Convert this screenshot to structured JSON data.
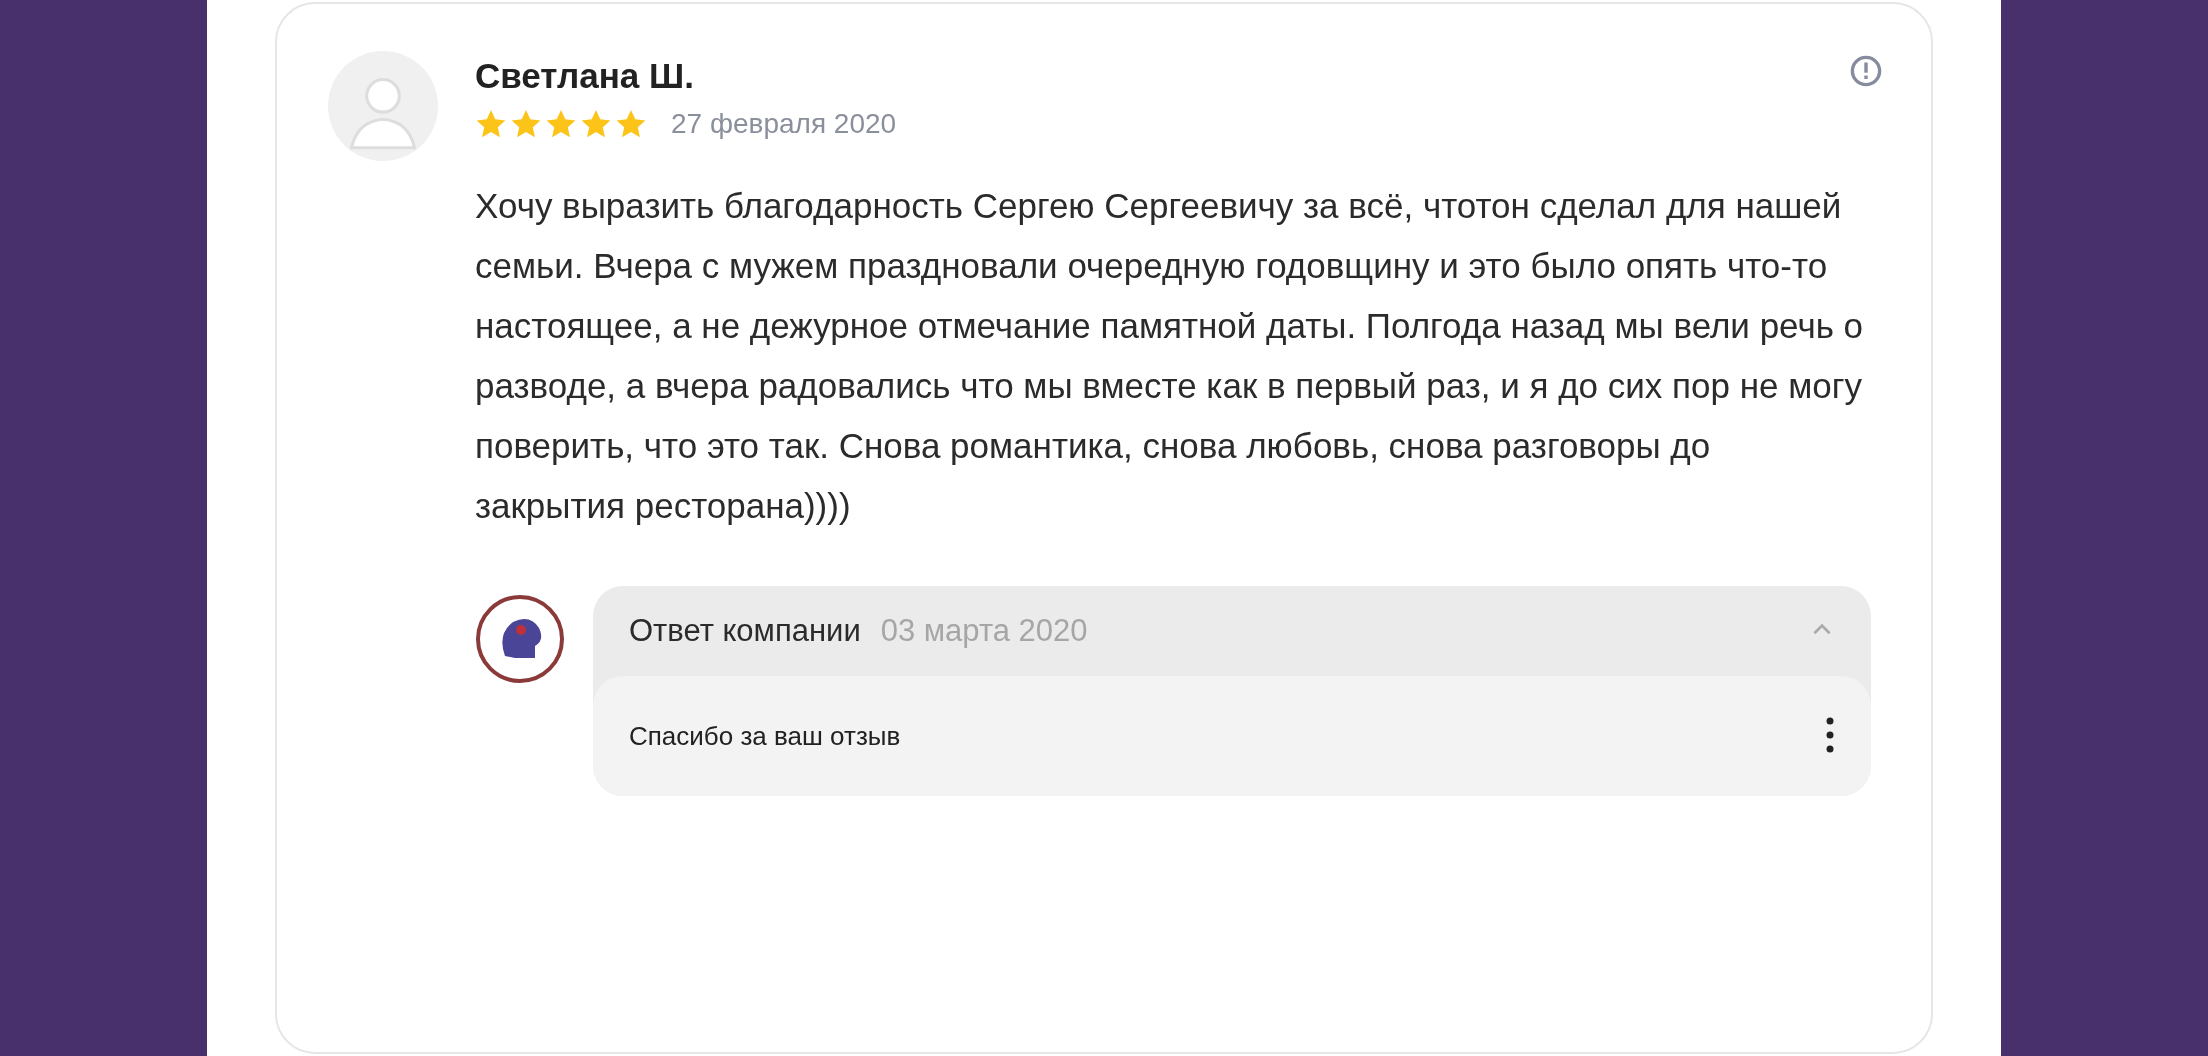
{
  "review": {
    "author": "Светлана Ш.",
    "stars": 5,
    "date": "27 февраля 2020",
    "text": "Хочу выразить благодарность Сергею Сергеевичу за всё, чтотон сделал для нашей семьи. Вчера с мужем праздновали очередную годовщину и это было опять что-то настоящее, а не дежурное отмечание памятной даты. Полгода назад мы вели речь о разводе, а вчера радовались что мы вместе как в первый раз, и я до сих пор не могу поверить, что это так. Снова романтика, снова любовь, снова разговоры до закрытия ресторана))))"
  },
  "reply": {
    "title": "Ответ компании",
    "date": "03 марта 2020",
    "expanded": true,
    "text": "Спасибо за ваш отзыв"
  }
}
